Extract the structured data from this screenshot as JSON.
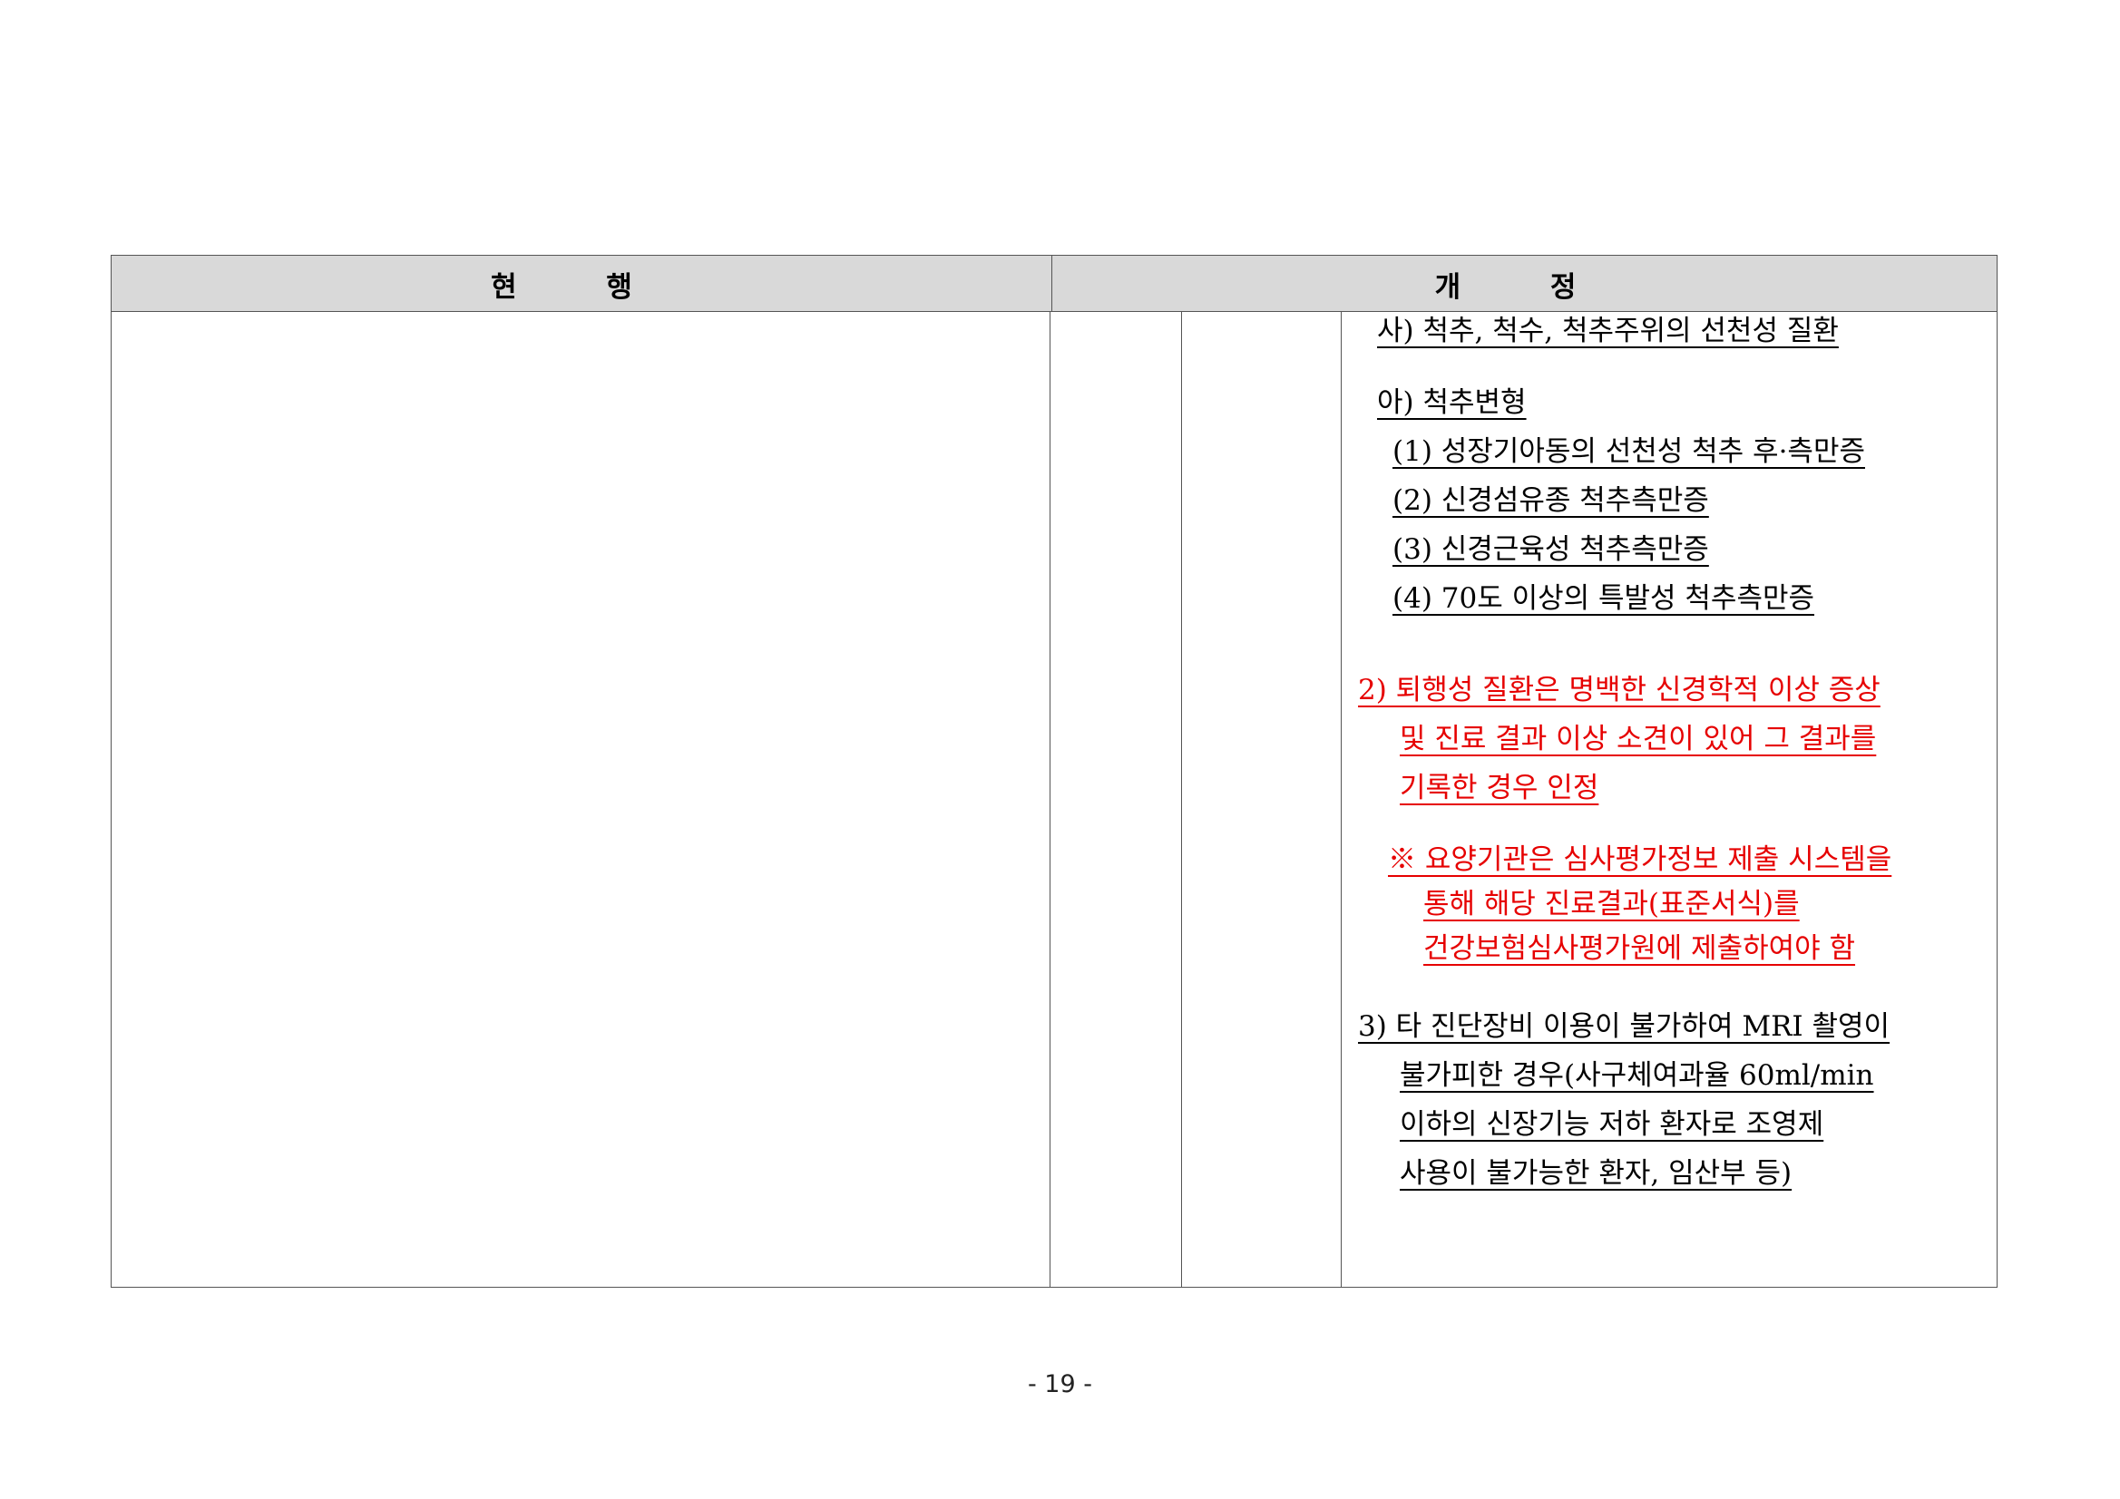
{
  "table": {
    "header": {
      "current": "현 행",
      "revised": "개 정"
    },
    "revised_lines": {
      "sa": "사) 척추, 척수, 척추주위의 선천성 질환",
      "a": "아) 척추변형",
      "a1": "(1) 성장기아동의 선천성 척추 후·측만증",
      "a2": "(2) 신경섬유종 척추측만증",
      "a3": "(3) 신경근육성 척추측만증",
      "a4": "(4) 70도 이상의 특발성 척추측만증",
      "item2_l1": "2) 퇴행성 질환은 명백한 신경학적 이상 증상",
      "item2_l2": "및 진료 결과 이상 소견이 있어 그 결과를",
      "item2_l3": "기록한 경우 인정",
      "note_l1": "※ 요양기관은 심사평가정보 제출 시스템을",
      "note_l2": "통해 해당 진료결과(표준서식)를",
      "note_l3": "건강보험심사평가원에 제출하여야 함",
      "item3_l1": "3) 타 진단장비 이용이 불가하여 MRI 촬영이",
      "item3_l2": "불가피한 경우(사구체여과율 60ml/min",
      "item3_l3": "이하의 신장기능 저하 환자로 조영제",
      "item3_l4": "사용이 불가능한 환자, 임산부 등)"
    }
  },
  "footer": {
    "page_number": "- 19 -"
  }
}
